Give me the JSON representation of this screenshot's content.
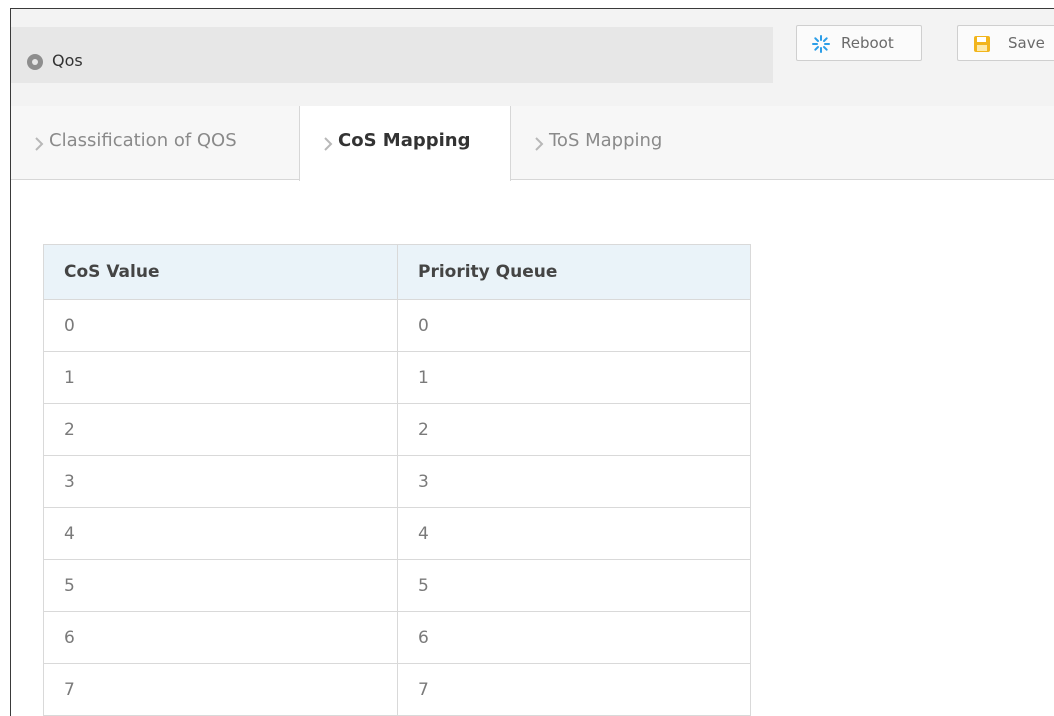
{
  "header": {
    "title": "Qos",
    "location_icon": "map-pin-icon",
    "buttons": {
      "reboot_label": "Reboot",
      "reboot_icon": "spinner-icon",
      "save_label": "Save",
      "save_icon": "floppy-disk-icon"
    }
  },
  "tabs": [
    {
      "label": "Classification of QOS",
      "active": false
    },
    {
      "label": "CoS Mapping",
      "active": true
    },
    {
      "label": "ToS Mapping",
      "active": false
    }
  ],
  "table": {
    "headers": [
      "CoS Value",
      "Priority Queue"
    ],
    "rows": [
      [
        "0",
        "0"
      ],
      [
        "1",
        "1"
      ],
      [
        "2",
        "2"
      ],
      [
        "3",
        "3"
      ],
      [
        "4",
        "4"
      ],
      [
        "5",
        "5"
      ],
      [
        "6",
        "6"
      ],
      [
        "7",
        "7"
      ]
    ]
  },
  "colors": {
    "header_bg": "#f3f3f3",
    "title_strip_bg": "#e7e7e7",
    "table_header_bg": "#eaf3f9",
    "border": "#d9d9d9",
    "reboot_icon_color": "#2b9ee8",
    "save_icon_color": "#f2b51c"
  }
}
